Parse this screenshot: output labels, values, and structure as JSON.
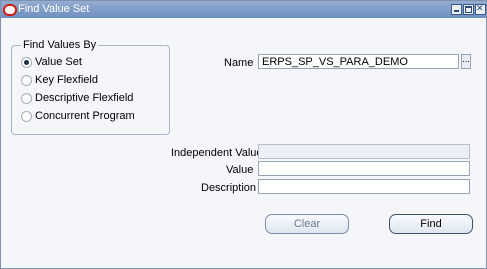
{
  "window": {
    "title": "Find Value Set",
    "icon": "oracle-icon"
  },
  "find_values_by": {
    "title": "Find Values By",
    "options": [
      {
        "label": "Value Set",
        "selected": true
      },
      {
        "label": "Key Flexfield",
        "selected": false
      },
      {
        "label": "Descriptive Flexfield",
        "selected": false
      },
      {
        "label": "Concurrent Program",
        "selected": false
      }
    ]
  },
  "form": {
    "name_label": "Name",
    "name_value": "ERPS_SP_VS_PARA_DEMO",
    "lov_button": "...",
    "independent_value_label": "Independent Value",
    "independent_value": "",
    "value_label": "Value",
    "value_value": "",
    "description_label": "Description",
    "description_value": ""
  },
  "buttons": {
    "clear": "Clear",
    "find": "Find"
  }
}
